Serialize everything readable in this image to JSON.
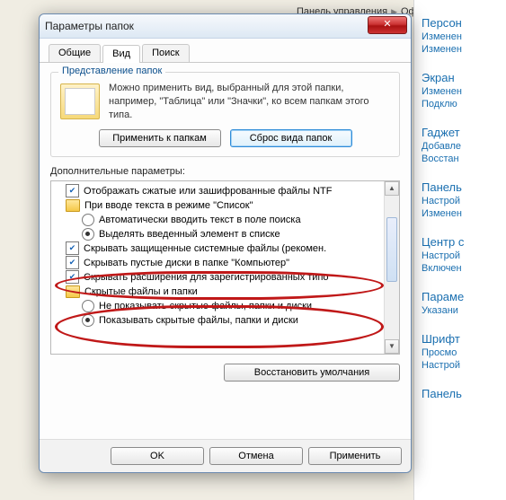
{
  "breadcrumb": {
    "part1": "Панель управления",
    "part2": "Оформлени"
  },
  "dialog": {
    "title": "Параметры папок",
    "close": "✕",
    "tabs": {
      "general": "Общие",
      "view": "Вид",
      "search": "Поиск"
    },
    "group_title": "Представление папок",
    "present_text": "Можно применить вид, выбранный для этой папки, например, \"Таблица\" или \"Значки\", ко всем папкам этого типа.",
    "apply_folders": "Применить к папкам",
    "reset_folders": "Сброс вида папок",
    "advanced_label": "Дополнительные параметры:",
    "tree": {
      "n1": "Отображать сжатые или зашифрованные файлы NTF",
      "n2": "При вводе текста в режиме \"Список\"",
      "n3": "Автоматически вводить текст в поле поиска",
      "n4": "Выделять введенный элемент в списке",
      "n5": "Скрывать защищенные системные файлы (рекомен.",
      "n6": "Скрывать пустые диски в папке \"Компьютер\"",
      "n7": "Скрывать расширения для зарегистрированных типо",
      "n8": "Скрытые файлы и папки",
      "n9": "Не показывать скрытые файлы, папки и диски",
      "n10": "Показывать скрытые файлы, папки и диски"
    },
    "restore_defaults": "Восстановить умолчания",
    "ok": "OK",
    "cancel": "Отмена",
    "apply": "Применить"
  },
  "side": {
    "g1": {
      "h": "Персон",
      "l1": "Изменен",
      "l2": "Изменен"
    },
    "g2": {
      "h": "Экран",
      "l1": "Изменен",
      "l2": "Подклю"
    },
    "g3": {
      "h": "Гаджет",
      "l1": "Добавле",
      "l2": "Восстан"
    },
    "g4": {
      "h": "Панель",
      "l1": "Настрой",
      "l2": "Изменен"
    },
    "g5": {
      "h": "Центр с",
      "l1": "Настрой",
      "l2": "Включен"
    },
    "g6": {
      "h": "Параме",
      "l1": "Указани"
    },
    "g7": {
      "h": "Шрифт",
      "l1": "Просмо",
      "l2": "Настрой"
    },
    "g8": {
      "h": "Панель"
    }
  }
}
